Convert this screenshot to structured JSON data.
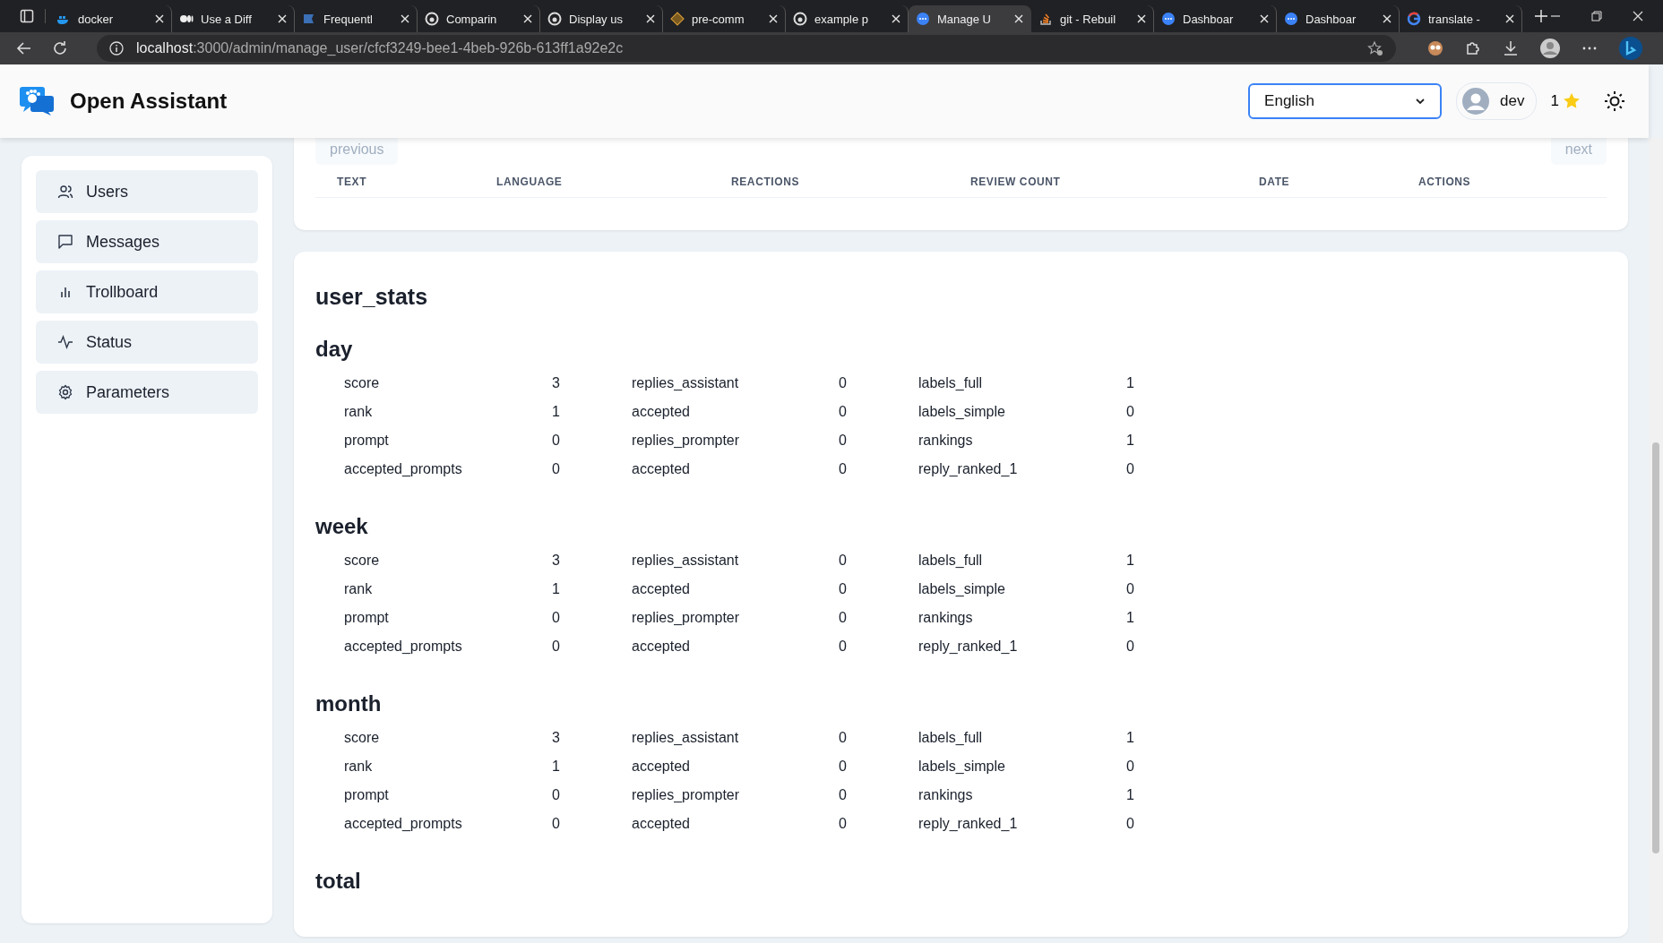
{
  "browser": {
    "tabs": [
      {
        "title": "docker",
        "kind": "docker",
        "selected": false
      },
      {
        "title": "Use a Diff",
        "kind": "medium",
        "selected": false
      },
      {
        "title": "Frequentl",
        "kind": "flag",
        "selected": false
      },
      {
        "title": "Comparin",
        "kind": "github",
        "selected": false
      },
      {
        "title": "Display us",
        "kind": "github",
        "selected": false
      },
      {
        "title": "pre-comm",
        "kind": "precommit",
        "selected": false
      },
      {
        "title": "example p",
        "kind": "github",
        "selected": false
      },
      {
        "title": "Manage U",
        "kind": "dots",
        "selected": true
      },
      {
        "title": "git - Rebuil",
        "kind": "stack",
        "selected": false
      },
      {
        "title": "Dashboar",
        "kind": "dots",
        "selected": false
      },
      {
        "title": "Dashboar",
        "kind": "dots",
        "selected": false
      },
      {
        "title": "translate -",
        "kind": "google",
        "selected": false
      }
    ],
    "address": {
      "host": "localhost",
      "path": ":3000/admin/manage_user/cfcf3249-bee1-4beb-926b-613ff1a92e2c"
    }
  },
  "header": {
    "brand": "Open Assistant",
    "language": "English",
    "user": "dev",
    "score": "1"
  },
  "sidebar": {
    "items": [
      {
        "label": "Users",
        "kind": "users",
        "selected": false
      },
      {
        "label": "Messages",
        "kind": "message",
        "selected": false
      },
      {
        "label": "Trollboard",
        "kind": "chart",
        "selected": false
      },
      {
        "label": "Status",
        "kind": "pulse",
        "selected": false
      },
      {
        "label": "Parameters",
        "kind": "gear",
        "selected": false
      }
    ]
  },
  "messages_table": {
    "previous": "previous",
    "next": "next",
    "columns": [
      "TEXT",
      "LANGUAGE",
      "REACTIONS",
      "REVIEW COUNT",
      "DATE",
      "ACTIONS"
    ]
  },
  "user_stats": {
    "title": "user_stats",
    "periods": [
      {
        "name": "day",
        "rows": [
          [
            {
              "label": "score",
              "value": "3"
            },
            {
              "label": "replies_assistant",
              "value": "0"
            },
            {
              "label": "labels_full",
              "value": "1"
            }
          ],
          [
            {
              "label": "rank",
              "value": "1"
            },
            {
              "label": "accepted",
              "value": "0"
            },
            {
              "label": "labels_simple",
              "value": "0"
            }
          ],
          [
            {
              "label": "prompt",
              "value": "0"
            },
            {
              "label": "replies_prompter",
              "value": "0"
            },
            {
              "label": "rankings",
              "value": "1"
            }
          ],
          [
            {
              "label": "accepted_prompts",
              "value": "0"
            },
            {
              "label": "accepted",
              "value": "0"
            },
            {
              "label": "reply_ranked_1",
              "value": "0"
            }
          ]
        ]
      },
      {
        "name": "week",
        "rows": [
          [
            {
              "label": "score",
              "value": "3"
            },
            {
              "label": "replies_assistant",
              "value": "0"
            },
            {
              "label": "labels_full",
              "value": "1"
            }
          ],
          [
            {
              "label": "rank",
              "value": "1"
            },
            {
              "label": "accepted",
              "value": "0"
            },
            {
              "label": "labels_simple",
              "value": "0"
            }
          ],
          [
            {
              "label": "prompt",
              "value": "0"
            },
            {
              "label": "replies_prompter",
              "value": "0"
            },
            {
              "label": "rankings",
              "value": "1"
            }
          ],
          [
            {
              "label": "accepted_prompts",
              "value": "0"
            },
            {
              "label": "accepted",
              "value": "0"
            },
            {
              "label": "reply_ranked_1",
              "value": "0"
            }
          ]
        ]
      },
      {
        "name": "month",
        "rows": [
          [
            {
              "label": "score",
              "value": "3"
            },
            {
              "label": "replies_assistant",
              "value": "0"
            },
            {
              "label": "labels_full",
              "value": "1"
            }
          ],
          [
            {
              "label": "rank",
              "value": "1"
            },
            {
              "label": "accepted",
              "value": "0"
            },
            {
              "label": "labels_simple",
              "value": "0"
            }
          ],
          [
            {
              "label": "prompt",
              "value": "0"
            },
            {
              "label": "replies_prompter",
              "value": "0"
            },
            {
              "label": "rankings",
              "value": "1"
            }
          ],
          [
            {
              "label": "accepted_prompts",
              "value": "0"
            },
            {
              "label": "accepted",
              "value": "0"
            },
            {
              "label": "reply_ranked_1",
              "value": "0"
            }
          ]
        ]
      },
      {
        "name": "total"
      }
    ]
  }
}
